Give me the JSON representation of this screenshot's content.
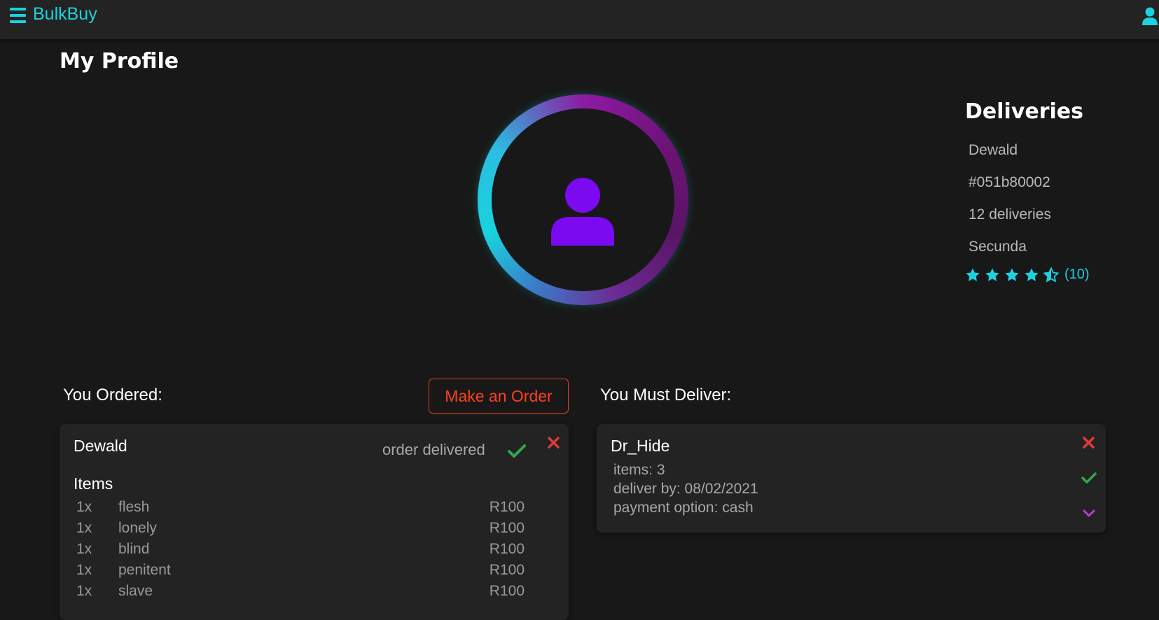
{
  "navbar": {
    "brand": "BulkBuy"
  },
  "page": {
    "title": "My Profile"
  },
  "deliveries": {
    "title": "Deliveries",
    "name": "Dewald",
    "id": "#051b80002",
    "count": "12 deliveries",
    "location": "Secunda",
    "rating_value": 4.5,
    "rating_max": 5,
    "rating_count": "(10)"
  },
  "ordered": {
    "label": "You Ordered:",
    "make_order_label": "Make an Order",
    "card": {
      "name": "Dewald",
      "status": "order delivered",
      "items_title": "Items",
      "items": [
        {
          "qty": "1x",
          "name": "flesh",
          "price": "R100"
        },
        {
          "qty": "1x",
          "name": "lonely",
          "price": "R100"
        },
        {
          "qty": "1x",
          "name": "blind",
          "price": "R100"
        },
        {
          "qty": "1x",
          "name": "penitent",
          "price": "R100"
        },
        {
          "qty": "1x",
          "name": "slave",
          "price": "R100"
        }
      ]
    }
  },
  "deliver": {
    "label": "You Must Deliver:",
    "card": {
      "name": "Dr_Hide",
      "items": "items: 3",
      "deliver_by": "deliver by: 08/02/2021",
      "payment": "payment option: cash"
    }
  },
  "colors": {
    "accent": "#1bd2de",
    "avatar": "#7b0af0",
    "danger": "#e53d22",
    "success": "#31a84f",
    "purple": "#b43fd6"
  },
  "icons": [
    "menu-icon",
    "user-icon",
    "person-icon",
    "star-icon",
    "star-half-icon",
    "check-icon",
    "close-icon",
    "chevron-down-icon"
  ]
}
